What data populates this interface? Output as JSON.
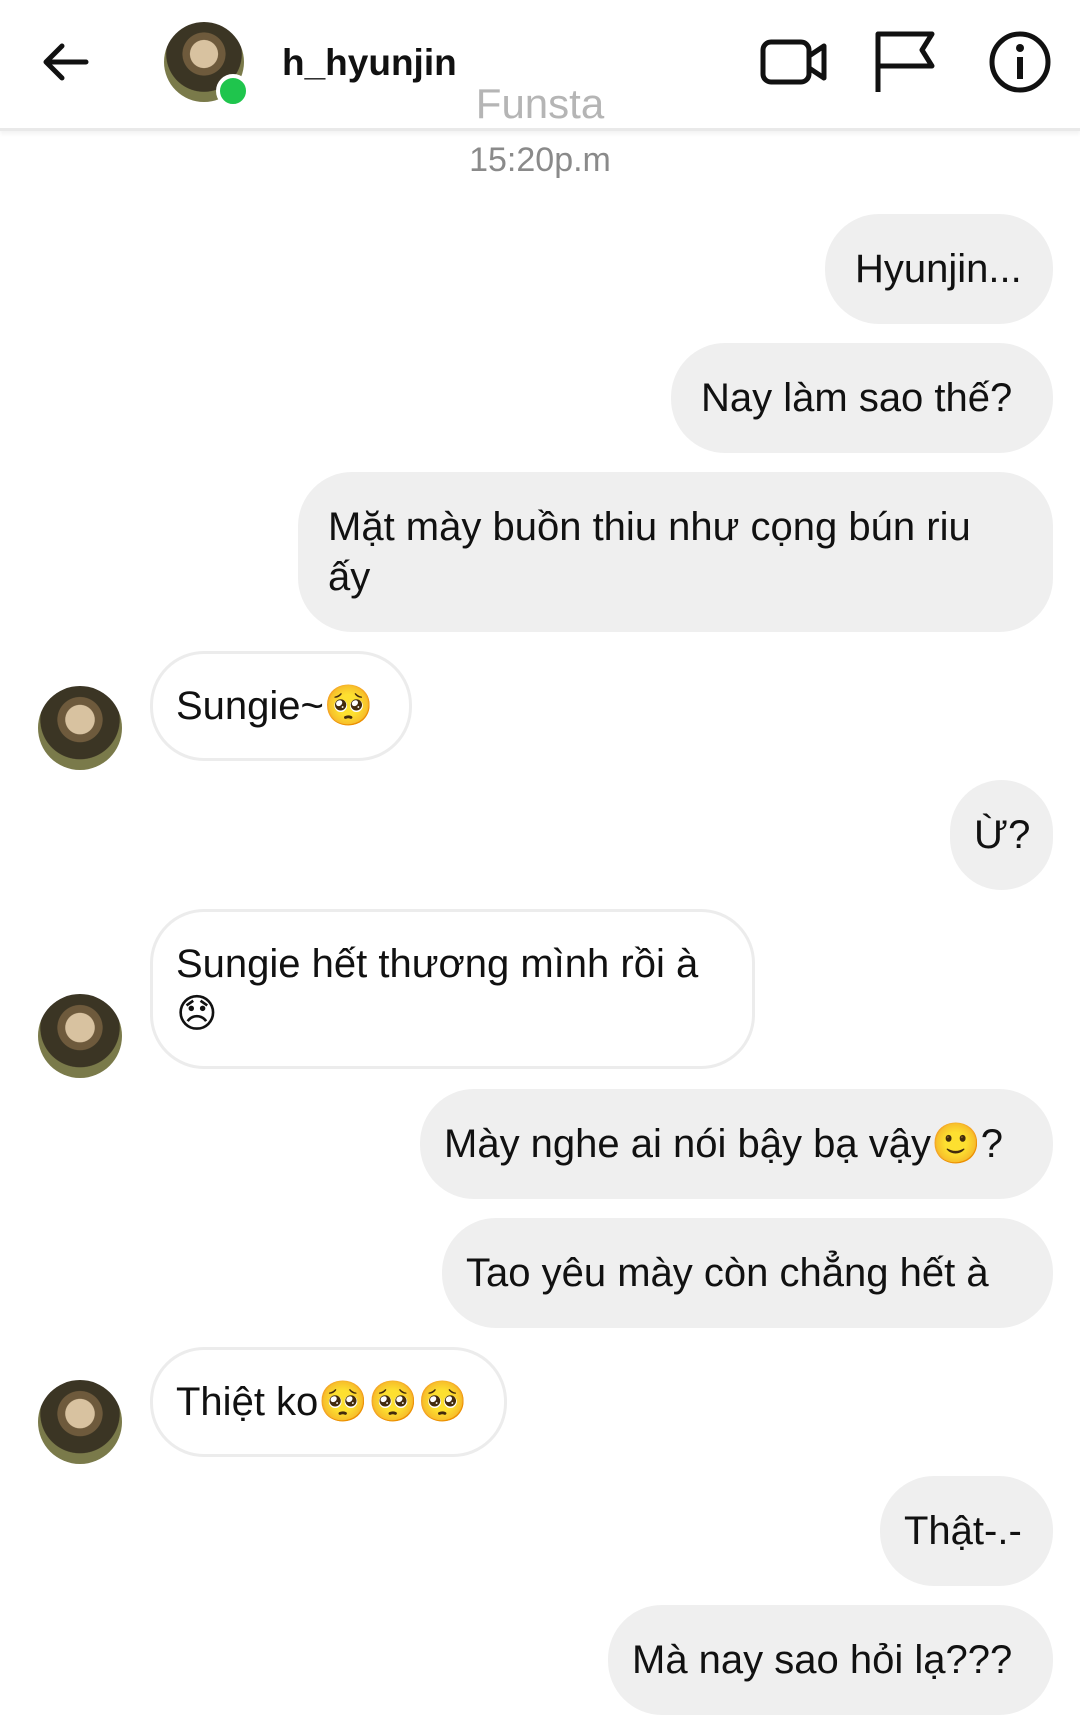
{
  "header": {
    "username": "h_hyunjin",
    "subtitle": "Funsta",
    "icons": [
      "back-arrow-icon",
      "video-call-icon",
      "flag-icon",
      "info-icon"
    ]
  },
  "timestamp": "15:20p.m",
  "messages": [
    {
      "side": "sent",
      "text": "Hyunjin..."
    },
    {
      "side": "sent",
      "text": "Nay làm sao thế?"
    },
    {
      "side": "sent",
      "text": "Mặt mày buồn thiu như cọng bún riu ấy"
    },
    {
      "side": "received",
      "text": "Sungie~🥺"
    },
    {
      "side": "sent",
      "text": "Ừ?"
    },
    {
      "side": "received",
      "text": "Sungie hết thương mình rồi à 😞"
    },
    {
      "side": "sent",
      "text": "Mày nghe ai nói bậy bạ vậy🙂?"
    },
    {
      "side": "sent",
      "text": "Tao yêu mày còn chẳng hết à"
    },
    {
      "side": "received",
      "text": "Thiệt ko🥺🥺🥺"
    },
    {
      "side": "sent",
      "text": "Thật-.-"
    },
    {
      "side": "sent",
      "text": "Mà nay sao hỏi lạ???"
    }
  ],
  "colors": {
    "sent_bubble": "#efefef",
    "received_border": "#ececec",
    "online": "#1fc54d"
  }
}
